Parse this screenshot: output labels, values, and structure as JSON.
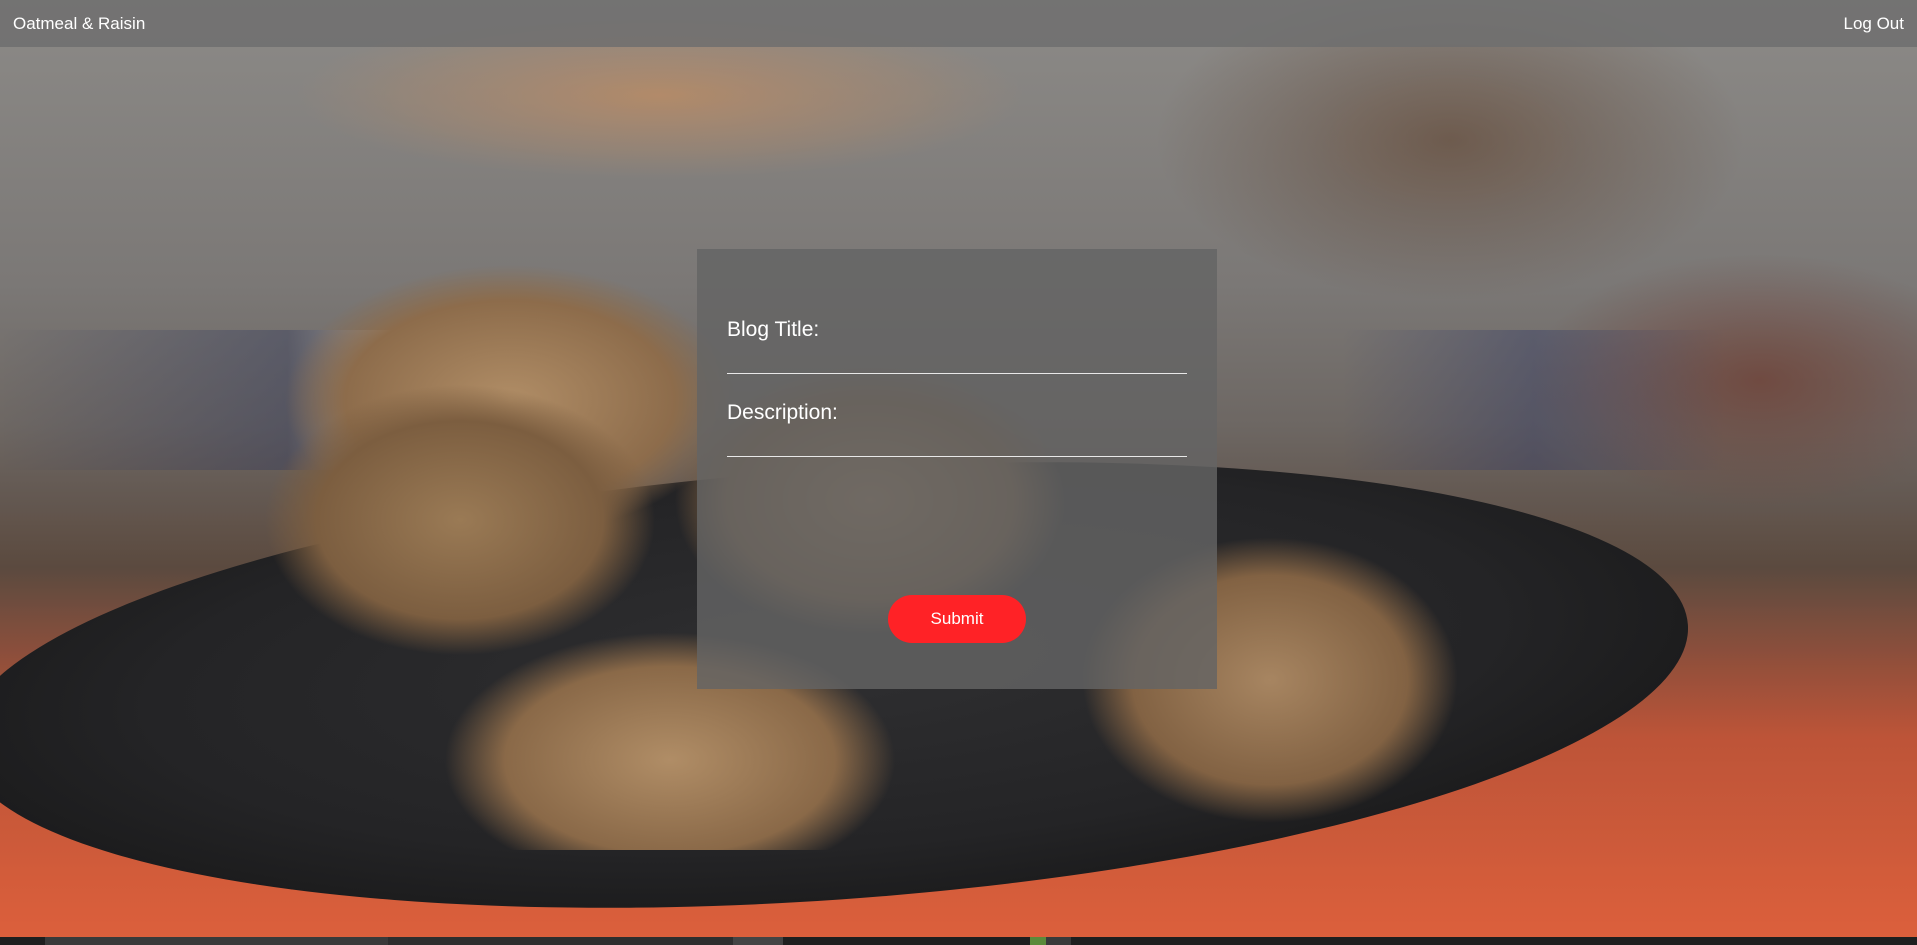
{
  "nav": {
    "brand": "Oatmeal & Raisin",
    "logout": "Log Out"
  },
  "form": {
    "title_label": "Blog Title:",
    "title_value": "",
    "description_label": "Description:",
    "description_value": "",
    "submit_label": "Submit"
  },
  "colors": {
    "submit_button": "#ff2226",
    "navbar": "#6e6e6e",
    "card": "#646464"
  }
}
